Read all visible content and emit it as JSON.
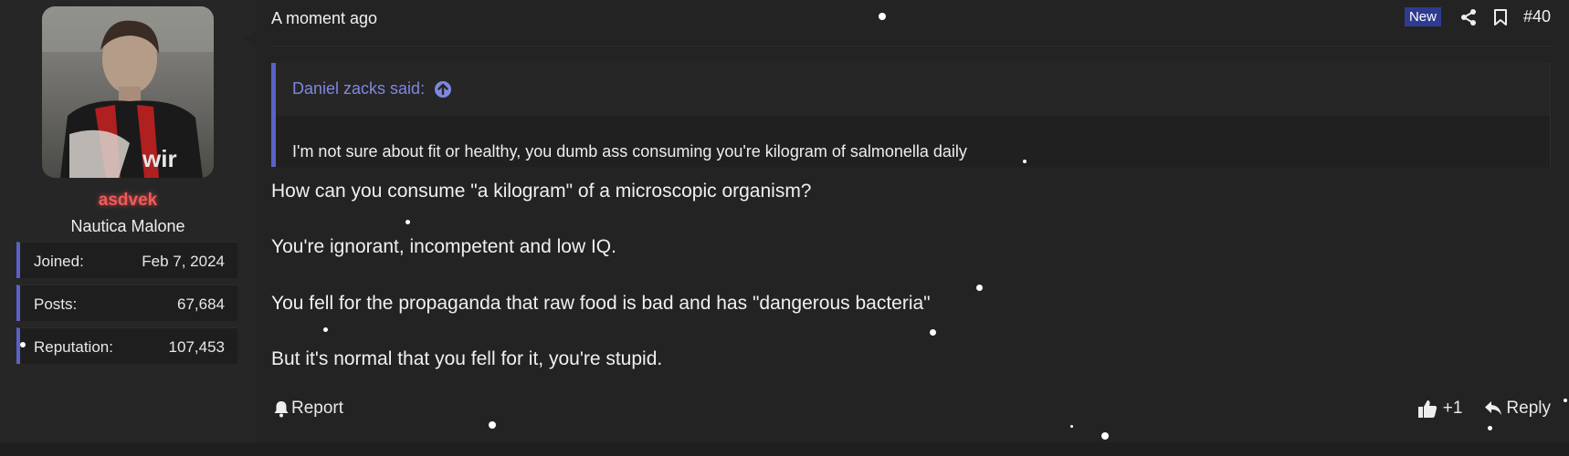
{
  "author": {
    "username": "asdvek",
    "title": "Nautica Malone",
    "stats": [
      {
        "label": "Joined:",
        "value": "Feb 7, 2024"
      },
      {
        "label": "Posts:",
        "value": "67,684"
      },
      {
        "label": "Reputation:",
        "value": "107,453"
      }
    ]
  },
  "post": {
    "date": "A moment ago",
    "badge": "New",
    "number": "#40",
    "quote": {
      "author_line": "Daniel zacks said:",
      "text": "I'm not sure about fit or healthy, you dumb ass consuming you're kilogram of salmonella daily"
    },
    "paragraphs": [
      "How can you consume \"a kilogram\" of a microscopic organism?",
      "You're ignorant, incompetent and low IQ.",
      "You fell for the propaganda that raw food is bad and has \"dangerous bacteria\"",
      "But it's normal that you fell for it, you're stupid."
    ],
    "actions": {
      "report": "Report",
      "reaction": "+1",
      "reply": "Reply"
    }
  },
  "icons": {
    "share": "share-icon",
    "bookmark": "bookmark-icon",
    "quote_jump": "arrow-up-circle-icon",
    "report": "bell-icon",
    "like": "thumbs-up-icon",
    "reply": "reply-icon"
  },
  "colors": {
    "accent": "#5b62c7",
    "username": "#f05a5a",
    "badge": "#2f3b8f"
  }
}
